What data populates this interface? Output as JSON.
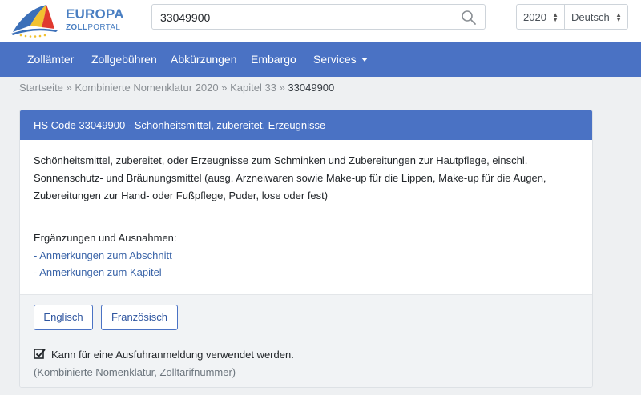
{
  "header": {
    "logo": {
      "title": "EUROPA",
      "sub_bold": "ZOLL",
      "sub_light": "PORTAL"
    },
    "search": {
      "value": "33049900",
      "icon": "search-icon"
    },
    "year_select": {
      "value": "2020"
    },
    "lang_select": {
      "value": "Deutsch"
    }
  },
  "nav": {
    "items": [
      {
        "label": "Zollämter"
      },
      {
        "label": "Zollgebühren"
      },
      {
        "label": "Abkürzungen"
      },
      {
        "label": "Embargo"
      },
      {
        "label": "Services"
      }
    ]
  },
  "breadcrumb": {
    "home": "Startseite",
    "level1": "Kombinierte Nomenklatur 2020",
    "level2": "Kapitel 33",
    "current": "33049900",
    "separator": "»"
  },
  "card": {
    "header": "HS Code 33049900 - Schönheitsmittel, zubereitet, Erzeugnisse",
    "description": "Schönheitsmittel, zubereitet, oder Erzeugnisse zum Schminken und Zubereitungen zur Hautpflege, einschl. Sonnenschutz- und Bräunungsmittel (ausg. Arzneiwaren sowie Make-up für die Lippen, Make-up für die Augen, Zubereitungen zur Hand- oder Fußpflege, Puder, lose oder fest)",
    "extras_title": "Ergänzungen und Ausnahmen:",
    "links": [
      {
        "label": "- Anmerkungen zum Abschnitt"
      },
      {
        "label": "- Anmerkungen zum Kapitel"
      }
    ],
    "buttons": {
      "english": "Englisch",
      "french": "Französisch"
    },
    "checkbox_label": "Kann für eine Ausfuhranmeldung verwendet werden.",
    "checkbox_checked": true,
    "note": "(Kombinierte Nomenklatur, Zolltarifnummer)"
  },
  "colors": {
    "brand_blue": "#4a72c4",
    "link_blue": "#3a64a8",
    "page_bg": "#eef0f2"
  }
}
